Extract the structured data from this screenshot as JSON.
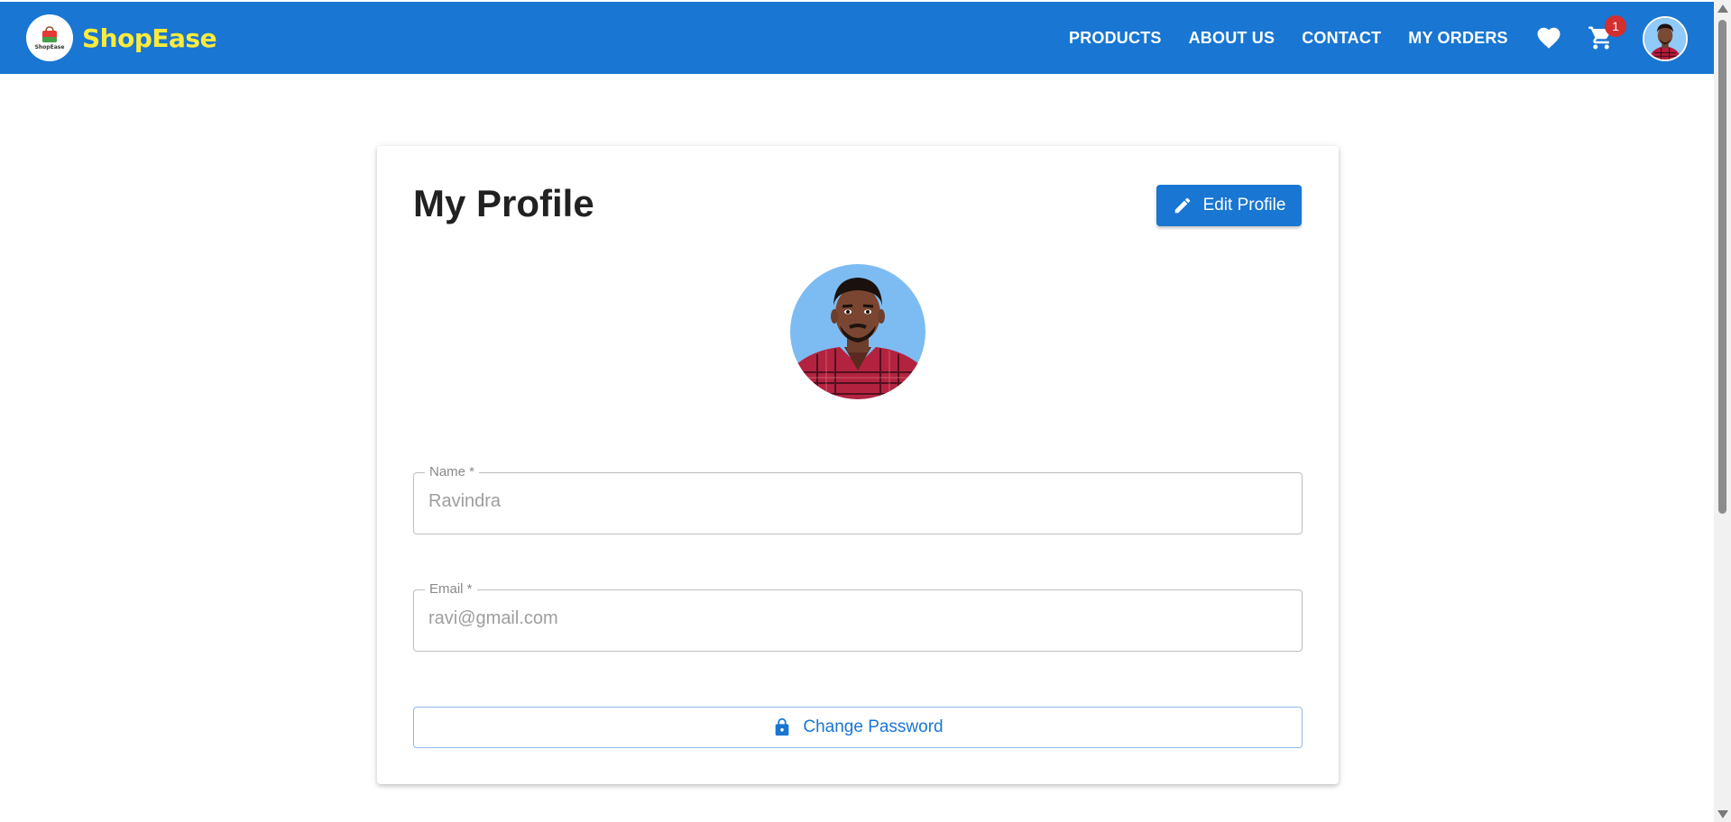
{
  "brand": {
    "logo_text": "ShopEase",
    "name": "ShopEase"
  },
  "nav": {
    "links": [
      "PRODUCTS",
      "ABOUT US",
      "CONTACT",
      "MY ORDERS"
    ],
    "cart_count": "1",
    "icons": [
      "heart-icon",
      "cart-icon",
      "user-avatar"
    ]
  },
  "profile": {
    "title": "My Profile",
    "edit_label": "Edit Profile",
    "name_label": "Name *",
    "name_value": "Ravindra",
    "email_label": "Email *",
    "email_value": "ravi@gmail.com",
    "change_password_label": "Change Password"
  },
  "colors": {
    "primary": "#1976d2",
    "brand_text": "#ffeb3b",
    "badge": "#d32f2f"
  }
}
